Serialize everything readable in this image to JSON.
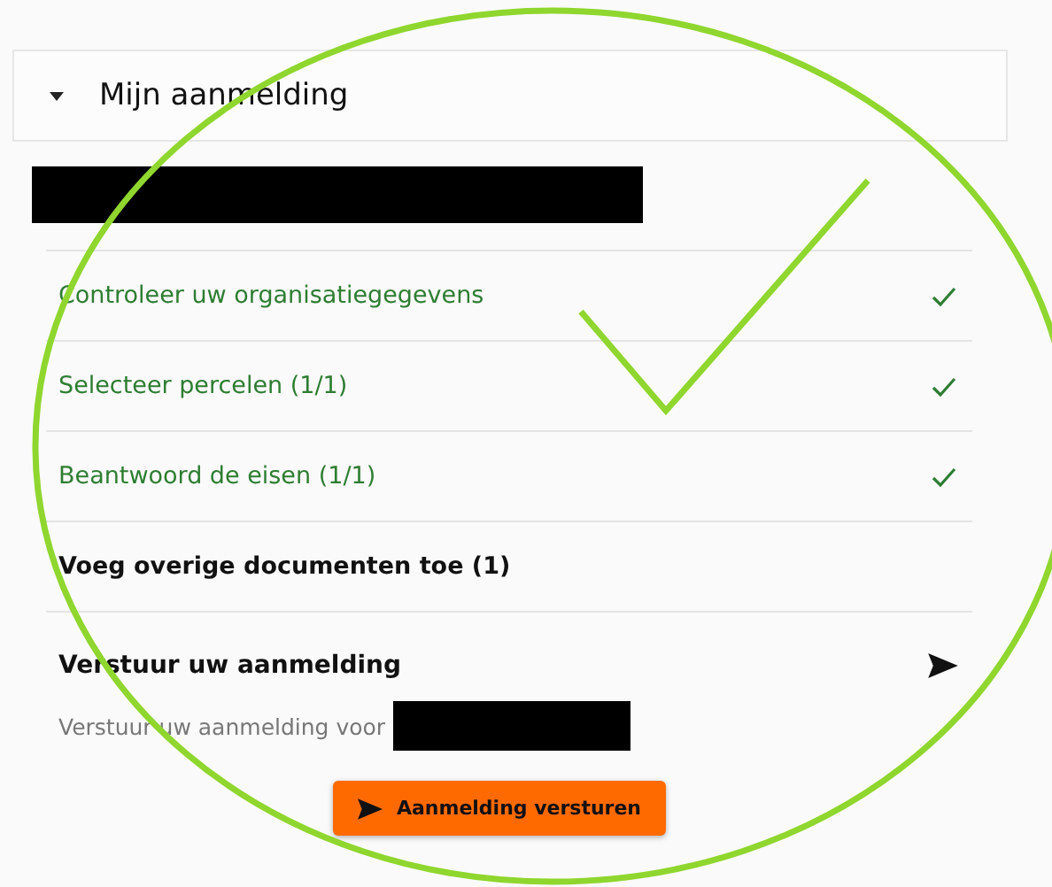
{
  "panel": {
    "title": "Mijn aanmelding",
    "expanded": true
  },
  "steps": [
    {
      "label": "Controleer uw organisatiegegevens",
      "completed": true
    },
    {
      "label": "Selecteer percelen (1/1)",
      "completed": true
    },
    {
      "label": "Beantwoord de eisen (1/1)",
      "completed": true
    },
    {
      "label": "Voeg overige documenten toe (1)",
      "completed": false
    }
  ],
  "submit": {
    "title": "Verstuur uw aanmelding",
    "description": "Verstuur uw aanmelding voor",
    "button": "Aanmelding versturen"
  }
}
